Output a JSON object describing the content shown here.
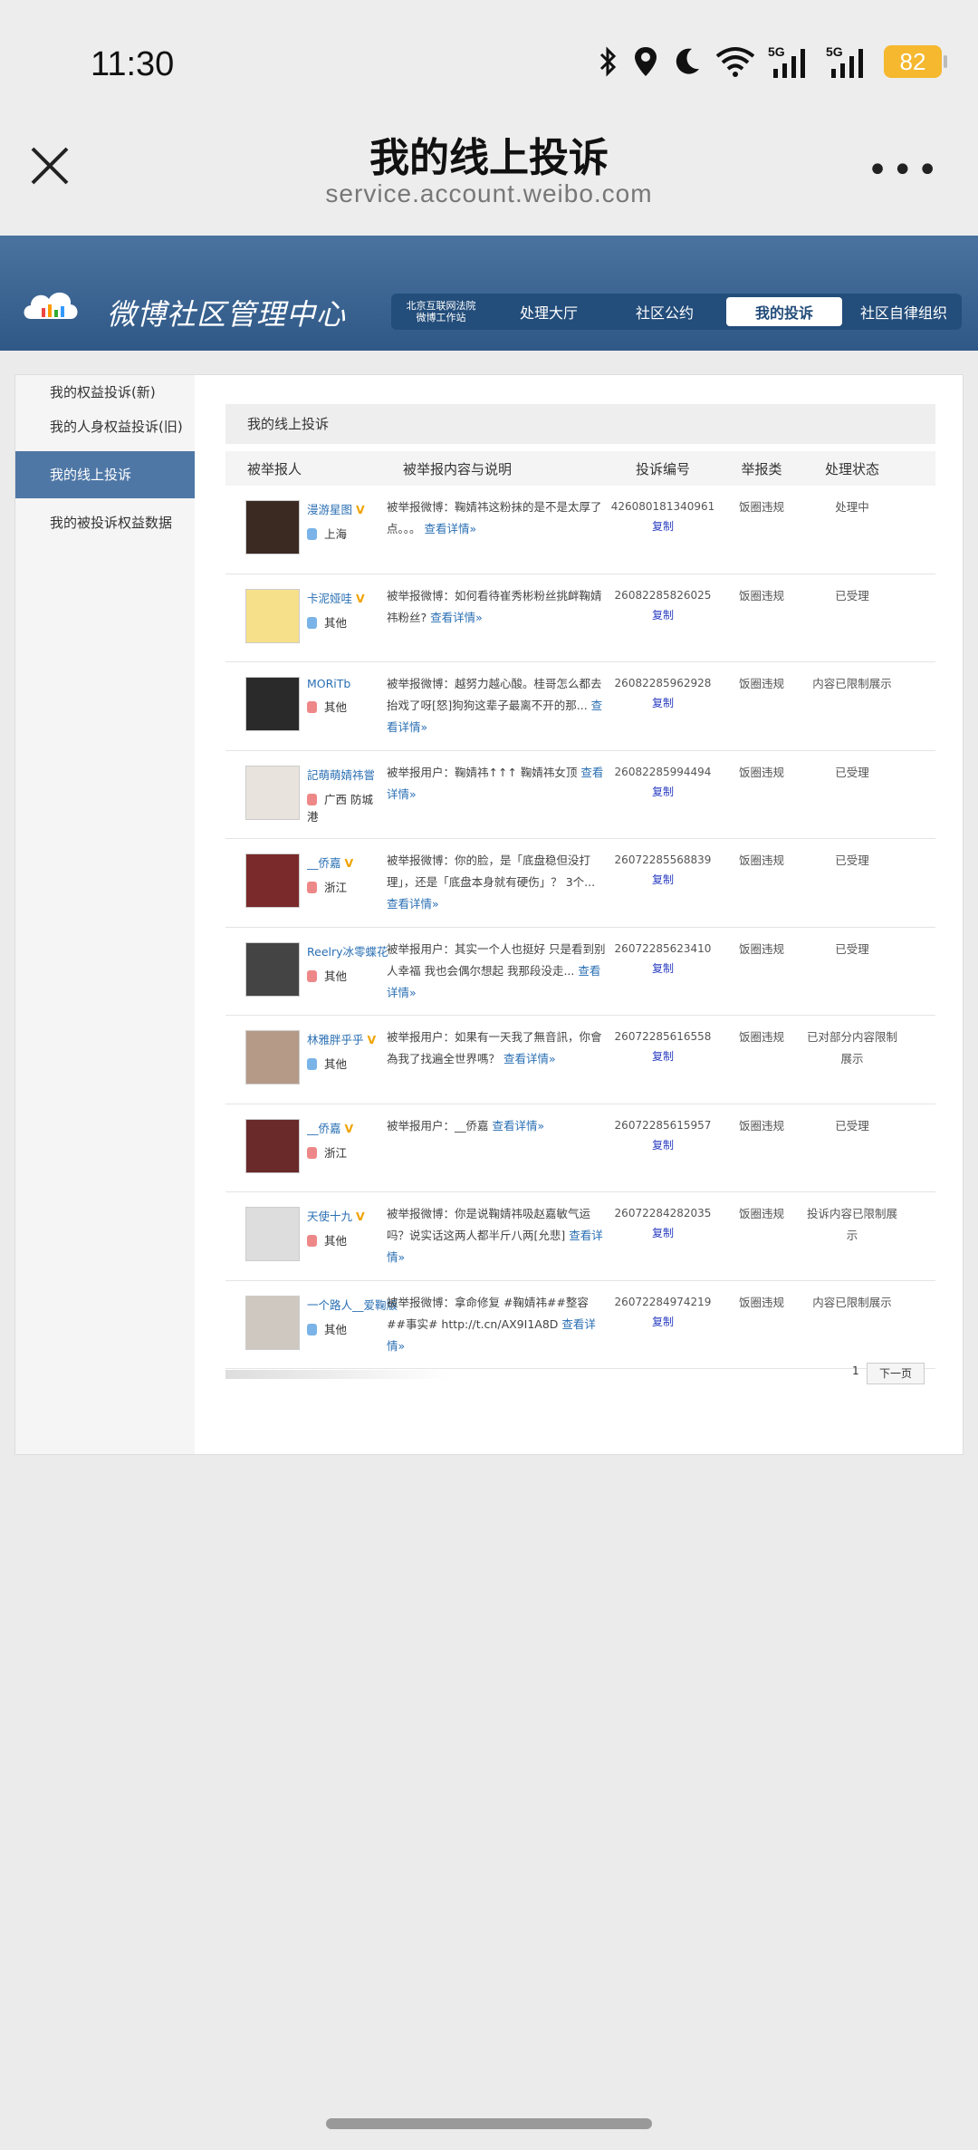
{
  "status_bar": {
    "time": "11:30",
    "battery": "82"
  },
  "browser": {
    "title": "我的线上投诉",
    "url": "service.account.weibo.com"
  },
  "site": {
    "title": "微博社区管理中心",
    "nav_court": "北京互联网法院\n微博工作站",
    "nav": [
      "处理大厅",
      "社区公约",
      "我的投诉",
      "社区自律组织"
    ]
  },
  "sidebar": {
    "items": [
      "我的权益投诉(新)",
      "我的人身权益投诉(旧)",
      "我的线上投诉",
      "我的被投诉权益数据"
    ]
  },
  "main": {
    "title": "我的线上投诉",
    "columns": [
      "被举报人",
      "被举报内容与说明",
      "投诉编号",
      "举报类",
      "处理状态"
    ],
    "copy_label": "复制",
    "rows": [
      {
        "name": "漫游星图",
        "v": "V",
        "loc": "上海",
        "content": "被举报微博：鞠婧祎这粉抹的是不是太厚了点。。。",
        "link": "查看详情»",
        "id": "426080181340961",
        "type": "饭圈违规",
        "status": "处理中"
      },
      {
        "name": "卡泥娅哇",
        "v": "V",
        "loc": "其他",
        "content": "被举报微博：如何看待崔秀彬粉丝挑衅鞠婧祎粉丝?",
        "link": "查看详情»",
        "id": "26082285826025",
        "type": "饭圈违规",
        "status": "已受理"
      },
      {
        "name": "MORiTb",
        "v": "",
        "loc": "其他",
        "content": "被举报微博：越努力越心酸。桂哥怎么都去抬戏了呀[怒]狗狗这辈子最离不开的那...",
        "link": "查看详情»",
        "id": "26082285962928",
        "type": "饭圈违规",
        "status": "内容已限制展示"
      },
      {
        "name": "記萌萌婧祎嘗",
        "v": "",
        "loc": "广西 防城港",
        "content": "被举报用户：鞠婧祎↑↑↑ 鞠婧祎女顶",
        "link": "查看详情»",
        "id": "26082285994494",
        "type": "饭圈违规",
        "status": "已受理"
      },
      {
        "name": "__侨嘉",
        "v": "V",
        "loc": "浙江",
        "content": "被举报微博：你的脸，是「底盘稳但没打理」，还是「底盘本身就有硬伤」？ 3个...",
        "link": "查看详情»",
        "id": "26072285568839",
        "type": "饭圈违规",
        "status": "已受理"
      },
      {
        "name": "Reelry冰零蝶花",
        "v": "",
        "loc": "其他",
        "content": "被举报用户：其实一个人也挺好 只是看到别人幸福 我也会偶尔想起 我那段没走...",
        "link": "查看详情»",
        "id": "26072285623410",
        "type": "饭圈违规",
        "status": "已受理"
      },
      {
        "name": "林雅胖乎乎",
        "v": "V",
        "loc": "其他",
        "content": "被举报用户：如果有一天我了無音訊，你會為我了找遍全世界嗎？",
        "link": "查看详情»",
        "id": "26072285616558",
        "type": "饭圈违规",
        "status": "已对部分内容限制展示"
      },
      {
        "name": "__侨嘉",
        "v": "V",
        "loc": "浙江",
        "content": "被举报用户：__侨嘉",
        "link": "查看详情»",
        "id": "26072285615957",
        "type": "饭圈违规",
        "status": "已受理"
      },
      {
        "name": "天使十九",
        "v": "V",
        "loc": "其他",
        "content": "被举报微博：你是说鞠婧祎吸赵嘉敏气运吗？说实话这两人都半斤八两[允悲]",
        "link": "查看详情»",
        "id": "26072284282035",
        "type": "饭圈违规",
        "status": "投诉内容已限制展示"
      },
      {
        "name": "一个路人__爱鞠版",
        "v": "",
        "loc": "其他",
        "content": "被举报微博：拿命修复 #鞠婧祎##整容##事实# http://t.cn/AX9I1A8D",
        "link": "查看详情»",
        "id": "26072284974219",
        "type": "饭圈违规",
        "status": "内容已限制展示"
      }
    ],
    "pager": {
      "page": "1",
      "next": "下一页"
    }
  }
}
